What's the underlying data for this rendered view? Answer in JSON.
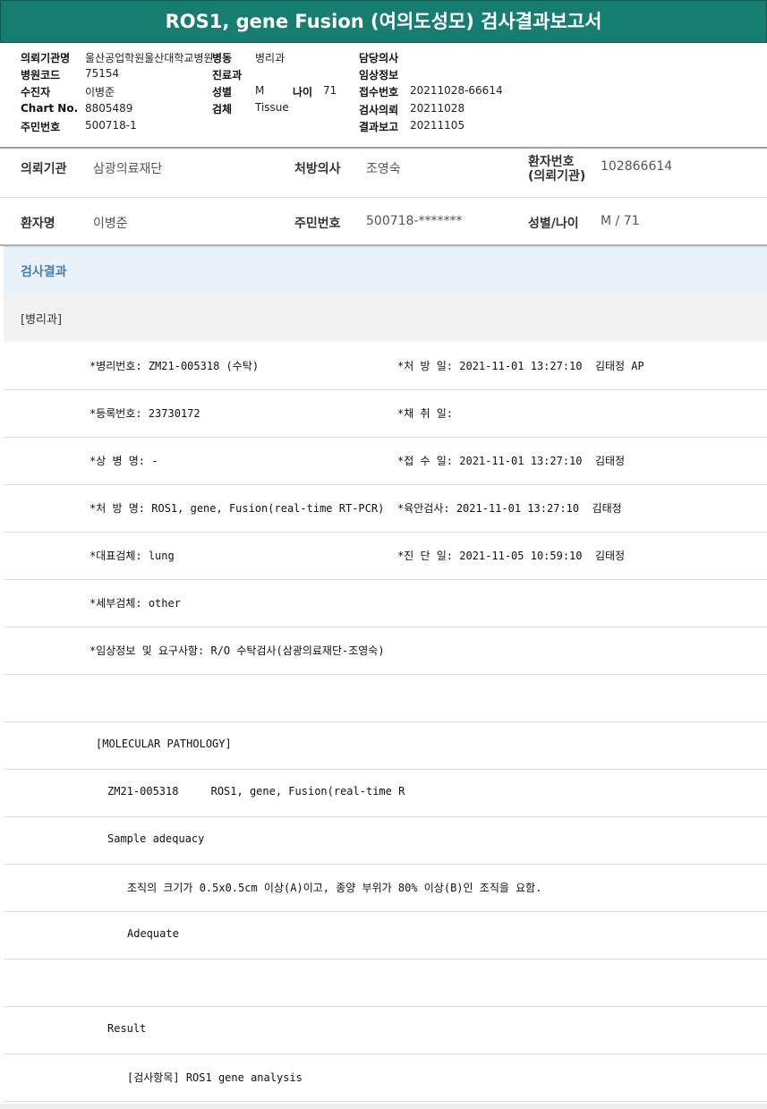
{
  "title": "ROS1, gene Fusion (여의도성모) 검사결과보고서",
  "header": {
    "institution_label": "의뢰기관명",
    "institution_value": "울산공업학원울산대학교병원",
    "ward_label": "병동",
    "ward_value": "병리과",
    "doctor_label": "담당의사",
    "doctor_value": "",
    "hospital_code_label": "병원코드",
    "hospital_code_value": "75154",
    "dept_label": "진료과",
    "dept_value": "",
    "clinical_info_label": "임상정보",
    "clinical_info_value": "",
    "patient_label": "수진자",
    "patient_value": "이병준",
    "sex_label": "성별",
    "sex_value": "M",
    "age_label": "나이",
    "age_value": "71",
    "receipt_label": "접수번호",
    "receipt_value": "20211028-66614",
    "chart_label": "Chart No.",
    "chart_value": "8805489",
    "specimen_label": "검체",
    "specimen_value": "Tissue",
    "request_label": "검사의뢰",
    "request_value": "20211028",
    "rrn_label": "주민번호",
    "rrn_value": "500718-1",
    "report_label": "결과보고",
    "report_value": "20211105"
  },
  "patient_info": {
    "row1": {
      "institution_label": "의뢰기관",
      "institution_value": "삼광의료재단",
      "physician_label": "처방의사",
      "physician_value": "조영숙",
      "patient_no_label_1": "환자번호",
      "patient_no_label_2": "(의뢰기관)",
      "patient_no_value": "102866614"
    },
    "row2": {
      "name_label": "환자명",
      "name_value": "이병준",
      "rrn_label": "주민번호",
      "rrn_value": "500718-*******",
      "sexage_label": "성별/나이",
      "sexage_value": "M / 71"
    }
  },
  "result_header": "검사결과",
  "pathology_header": "[병리과]",
  "rows": [
    {
      "left": "*병리번호: ZM21-005318 (수탁)",
      "right": "*처 방 일: 2021-11-01 13:27:10  김태정 AP"
    },
    {
      "left": "*등록번호: 23730172",
      "right": "*채 취 일:"
    },
    {
      "left": "*상 병 명: -",
      "right": "*접 수 일: 2021-11-01 13:27:10  김태정"
    },
    {
      "left": "*처 방 명: ROS1, gene, Fusion(real-time RT-PCR)",
      "right": "*육안검사: 2021-11-01 13:27:10  김태정"
    },
    {
      "left": "*대표검체: lung",
      "right": "*진 단 일: 2021-11-05 10:59:10  김태정"
    },
    {
      "left": "*세부검체: other",
      "right": ""
    },
    {
      "left": "*임상정보 및 요구사항: R/O 수탁검사(삼광의료재단-조영숙)",
      "right": ""
    },
    {
      "left": "",
      "right": ""
    },
    {
      "left": "[MOLECULAR PATHOLOGY]",
      "right": ""
    },
    {
      "left": "ZM21-005318     ROS1, gene, Fusion(real-time R",
      "right": ""
    },
    {
      "left": "Sample adequacy",
      "right": ""
    },
    {
      "left": "조직의 크기가 0.5x0.5cm 이상(A)이고, 종양 부위가 80% 이상(B)인 조직을 요함.",
      "right": ""
    },
    {
      "left": "Adequate",
      "right": ""
    },
    {
      "left": "",
      "right": ""
    },
    {
      "left": "Result",
      "right": ""
    },
    {
      "left": "[검사항목] ROS1 gene analysis",
      "right": ""
    }
  ]
}
